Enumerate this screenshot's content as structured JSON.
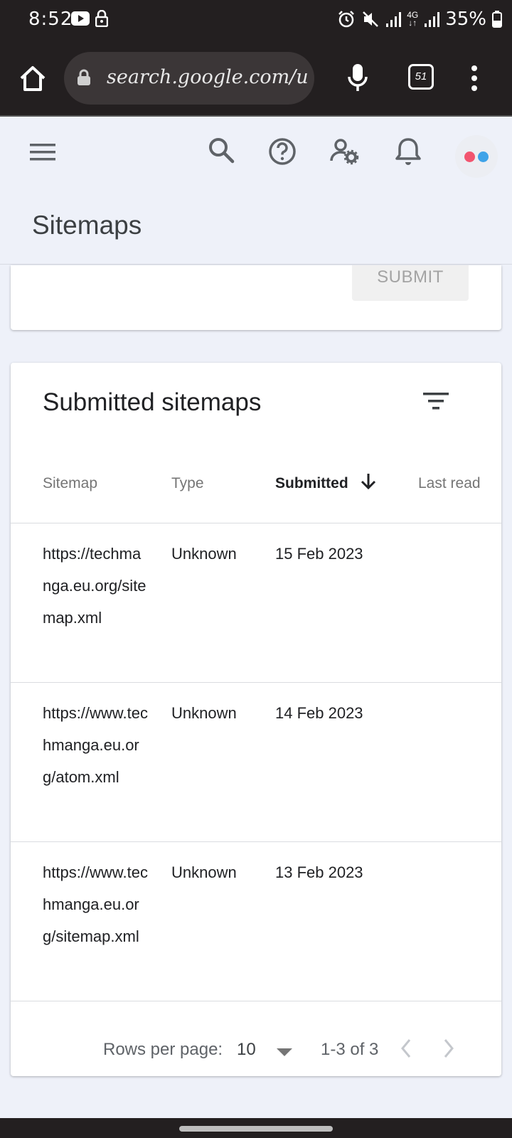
{
  "status": {
    "time": "8:52",
    "battery": "35%",
    "network": "4G"
  },
  "browser": {
    "url": "search.google.com/u",
    "tab_count": "51"
  },
  "header": {
    "title": "Sitemaps"
  },
  "submit_form": {
    "submit_label": "SUBMIT"
  },
  "submitted": {
    "title": "Submitted sitemaps",
    "columns": {
      "sitemap": "Sitemap",
      "type": "Type",
      "submitted": "Submitted",
      "last_read": "Last read"
    },
    "rows": [
      {
        "url": "https://techmanga.eu.org/sitemap.xml",
        "type": "Unknown",
        "submitted": "15 Feb 2023"
      },
      {
        "url": "https://www.techmanga.eu.org/atom.xml",
        "type": "Unknown",
        "submitted": "14 Feb 2023"
      },
      {
        "url": "https://www.techmanga.eu.org/sitemap.xml",
        "type": "Unknown",
        "submitted": "13 Feb 2023"
      }
    ],
    "footer": {
      "rows_per_page_label": "Rows per page:",
      "rows_per_page_value": "10",
      "range": "1-3 of 3"
    }
  },
  "colors": {
    "page_bg": "#eef1f9",
    "system_bar": "#231f20",
    "avatar_dot_pink": "#f2556f",
    "avatar_dot_blue": "#3fa3e8"
  }
}
